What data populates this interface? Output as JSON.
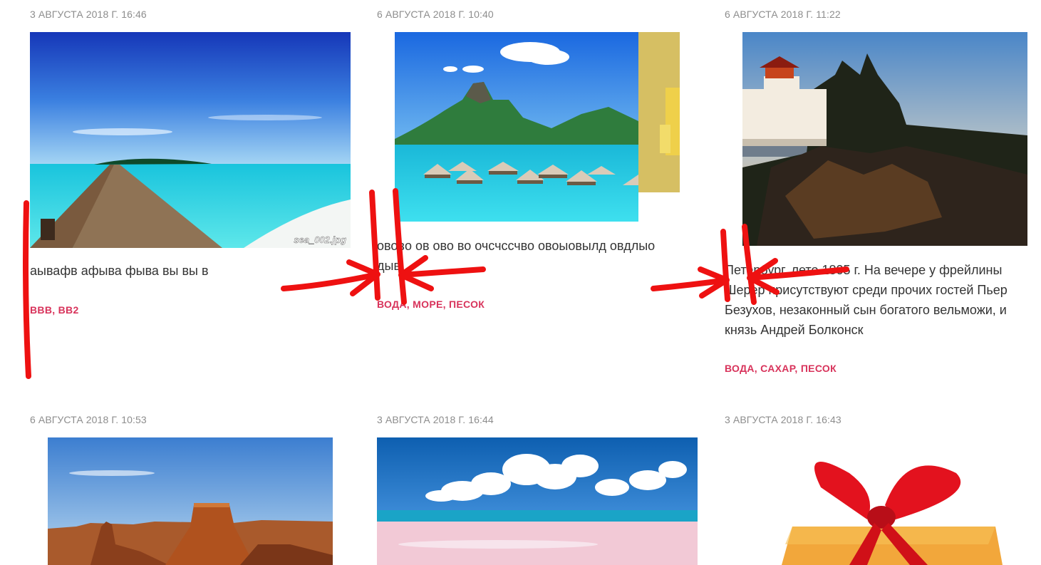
{
  "posts": [
    {
      "date": "3 АВГУСТА 2018 Г. 16:46",
      "image_caption": "sea_002.jpg",
      "excerpt": "аывафв афыва фыва вы вы в",
      "tags": [
        "BBB",
        "BB2"
      ]
    },
    {
      "date": "6 АВГУСТА 2018 Г. 10:40",
      "excerpt_line1": "ововo ов ово во очсчссчво овоыовылд овдлыо",
      "excerpt_line2": "дыв",
      "tags": [
        "ВОДА",
        "МОРЕ",
        "ПЕСОК"
      ]
    },
    {
      "date": "6 АВГУСТА 2018 Г. 11:22",
      "excerpt_lines": [
        "Петербург, лето 1805 г. На вечере у фрейлины",
        "Шерер присутствуют среди прочих гостей Пьер",
        "Безухов, незаконный сын богатого вельможи, и",
        "князь Андрей Болконск"
      ],
      "tags": [
        "ВОДА",
        "САХАР",
        "ПЕСОК"
      ]
    },
    {
      "date": "6 АВГУСТА 2018 Г. 10:53"
    },
    {
      "date": "3 АВГУСТА 2018 Г. 16:44"
    },
    {
      "date": "3 АВГУСТА 2018 Г. 16:43"
    }
  ],
  "tag_separator": ",",
  "colors": {
    "tag": "#d8335b",
    "date": "#8d8d8d",
    "text": "#333333",
    "annotation": "#ee1111"
  }
}
